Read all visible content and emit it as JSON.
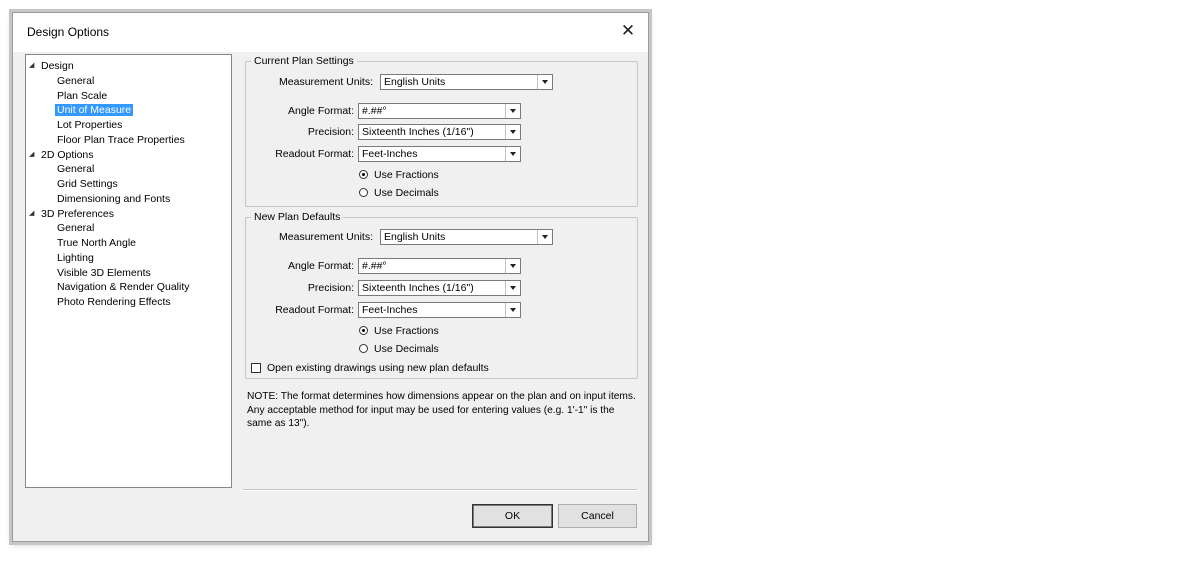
{
  "window": {
    "title": "Design Options",
    "close": "✕"
  },
  "tree": [
    {
      "label": "Design",
      "level": 0,
      "expanded": true
    },
    {
      "label": "General",
      "level": 1
    },
    {
      "label": "Plan Scale",
      "level": 1
    },
    {
      "label": "Unit of Measure",
      "level": 1,
      "selected": true
    },
    {
      "label": "Lot Properties",
      "level": 1
    },
    {
      "label": "Floor Plan Trace Properties",
      "level": 1
    },
    {
      "label": "2D Options",
      "level": 0,
      "expanded": true
    },
    {
      "label": "General",
      "level": 1
    },
    {
      "label": "Grid Settings",
      "level": 1
    },
    {
      "label": "Dimensioning and Fonts",
      "level": 1
    },
    {
      "label": "3D Preferences",
      "level": 0,
      "expanded": true
    },
    {
      "label": "General",
      "level": 1
    },
    {
      "label": "True North Angle",
      "level": 1
    },
    {
      "label": "Lighting",
      "level": 1
    },
    {
      "label": "Visible 3D Elements",
      "level": 1
    },
    {
      "label": "Navigation & Render Quality",
      "level": 1
    },
    {
      "label": "Photo Rendering Effects",
      "level": 1
    }
  ],
  "current": {
    "title": "Current Plan Settings",
    "measurement_label": "Measurement Units:",
    "measurement_value": "English Units",
    "angle_label": "Angle Format:",
    "angle_value": "#.##°",
    "precision_label": "Precision:",
    "precision_value": "Sixteenth Inches (1/16\")",
    "readout_label": "Readout Format:",
    "readout_value": "Feet-Inches",
    "fractions_label": "Use Fractions",
    "decimals_label": "Use Decimals",
    "selected": "fractions"
  },
  "defaults": {
    "title": "New Plan Defaults",
    "measurement_label": "Measurement Units:",
    "measurement_value": "English Units",
    "angle_label": "Angle Format:",
    "angle_value": "#.##°",
    "precision_label": "Precision:",
    "precision_value": "Sixteenth Inches (1/16\")",
    "readout_label": "Readout Format:",
    "readout_value": "Feet-Inches",
    "fractions_label": "Use Fractions",
    "decimals_label": "Use Decimals",
    "selected": "fractions",
    "open_existing_label": "Open existing drawings using new plan defaults",
    "open_existing_checked": false
  },
  "note": "NOTE:  The format determines how dimensions appear on the plan and on input items.  Any acceptable method for input may be used for entering values (e.g. 1'-1\" is the same as 13\").",
  "buttons": {
    "ok": "OK",
    "cancel": "Cancel"
  }
}
